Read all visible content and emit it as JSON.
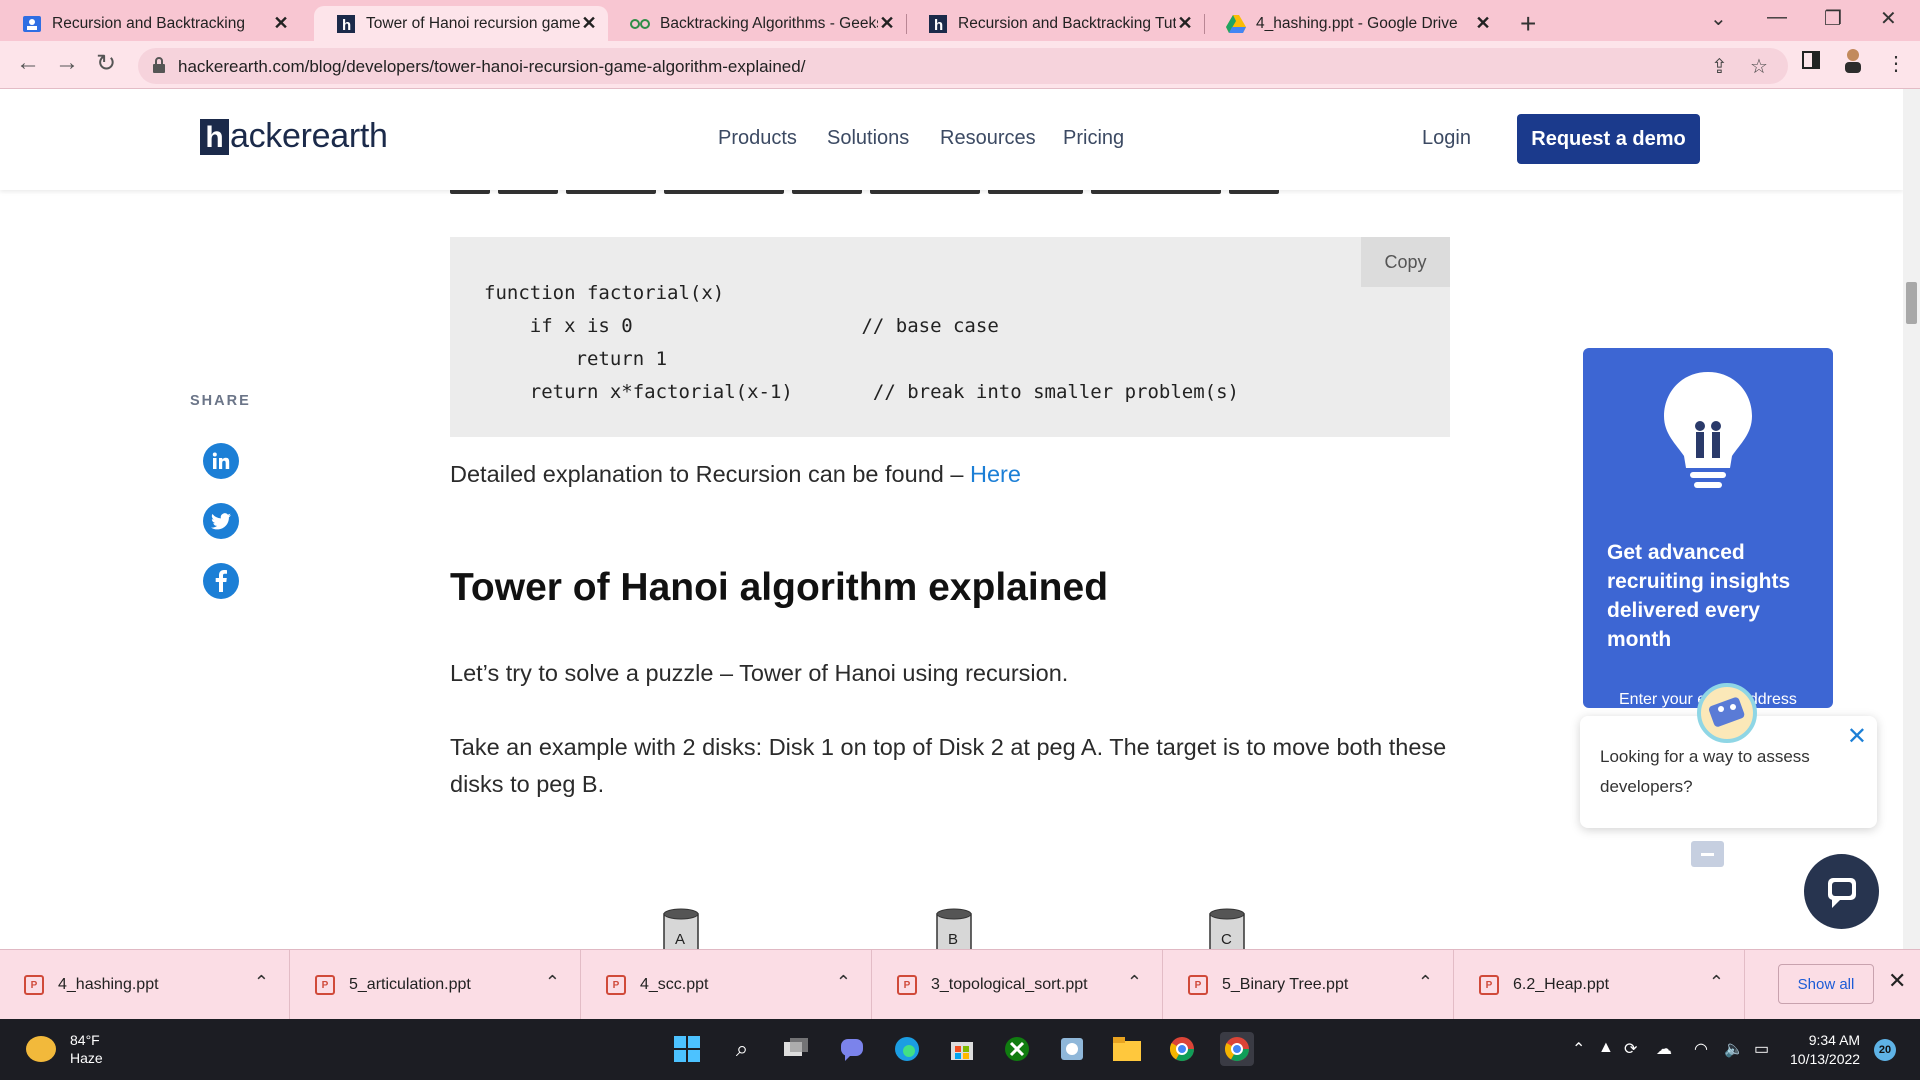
{
  "browser": {
    "tabs": [
      {
        "title": "Recursion and Backtracking",
        "icon": "classroom-icon",
        "active": false
      },
      {
        "title": "Tower of Hanoi recursion game a",
        "icon": "hackerearth-icon",
        "active": true
      },
      {
        "title": "Backtracking Algorithms - Geeks",
        "icon": "geeksforgeeks-icon",
        "active": false
      },
      {
        "title": "Recursion and Backtracking Tuto",
        "icon": "hackerearth-icon",
        "active": false
      },
      {
        "title": "4_hashing.ppt - Google Drive",
        "icon": "google-drive-icon",
        "active": false
      }
    ],
    "url": "hackerearth.com/blog/developers/tower-hanoi-recursion-game-algorithm-explained/"
  },
  "header": {
    "logo_letter": "h",
    "logo_text": "ackerearth",
    "nav": [
      "Products",
      "Solutions",
      "Resources",
      "Pricing"
    ],
    "login": "Login",
    "demo": "Request a demo"
  },
  "article": {
    "copy_label": "Copy",
    "code": "function factorial(x)\n    if x is 0                    // base case\n        return 1\n    return x*factorial(x-1)       // break into smaller problem(s)",
    "explanation_prefix": "Detailed explanation to Recursion can be found – ",
    "explanation_link": "Here",
    "heading": "Tower of Hanoi algorithm explained",
    "para1": "Let’s try to solve a puzzle – Tower of Hanoi using recursion.",
    "para2": "Take an example with 2 disks: Disk 1 on top of Disk 2 at peg A. The target is to move both these disks to peg B.",
    "pegs": [
      "A",
      "B",
      "C"
    ]
  },
  "share": {
    "label": "SHARE",
    "icons": [
      "linkedin-icon",
      "twitter-icon",
      "facebook-icon"
    ]
  },
  "promo": {
    "title": "Get advanced recruiting insights delivered every month",
    "email_placeholder": "Enter your email address"
  },
  "chat": {
    "message": "Looking for a way to assess developers?"
  },
  "downloads": {
    "items": [
      "4_hashing.ppt",
      "5_articulation.ppt",
      "4_scc.ppt",
      "3_topological_sort.ppt",
      "5_Binary Tree.ppt",
      "6.2_Heap.ppt"
    ],
    "show_all": "Show all"
  },
  "taskbar": {
    "temp": "84°F",
    "condition": "Haze",
    "time": "9:34 AM",
    "date": "10/13/2022",
    "notifications": "20"
  },
  "colors": {
    "brand_dark": "#1b2a4a",
    "accent_blue": "#1c7fd6",
    "demo_button": "#1b3a8c",
    "promo_bg": "#3d66d3",
    "tab_strip": "#f8c6d2"
  }
}
